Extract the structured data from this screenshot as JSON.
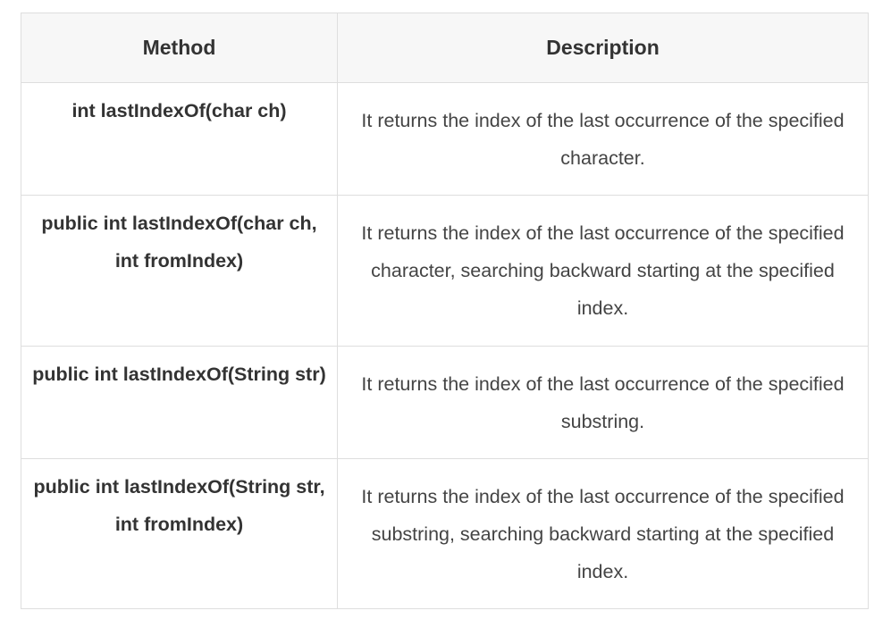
{
  "table": {
    "headers": {
      "method": "Method",
      "description": "Description"
    },
    "rows": [
      {
        "method": "int lastIndexOf(char ch)",
        "description": "It returns the index of the last occurrence of the specified character."
      },
      {
        "method": "public int lastIndexOf(char ch, int fromIndex)",
        "description": "It returns the index of the last occurrence of the specified character, searching backward starting at the specified index."
      },
      {
        "method": "public int lastIndexOf(String str)",
        "description": "It returns the index of the last occurrence of the specified substring."
      },
      {
        "method": "public int lastIndexOf(String str, int fromIndex)",
        "description": "It returns the index of the last occurrence of the specified substring, searching backward starting at the specified index."
      }
    ]
  }
}
